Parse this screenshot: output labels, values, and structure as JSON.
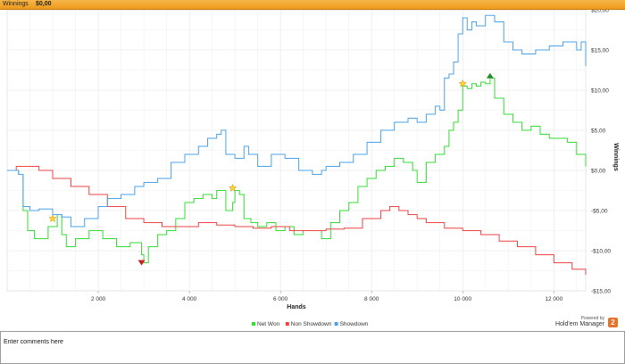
{
  "titlebar": {
    "label": "Winnings",
    "value": "$0,00"
  },
  "chart_data": {
    "type": "line",
    "title": "",
    "xlabel": "Hands",
    "ylabel": "Winnings",
    "xlim": [
      0,
      12700
    ],
    "ylim": [
      -15,
      20
    ],
    "grid": true,
    "legend_placement": "bottom-center",
    "x_ticks": [
      2000,
      4000,
      6000,
      8000,
      10000,
      12000
    ],
    "x_tick_labels": [
      "2 000",
      "4 000",
      "6 000",
      "8 000",
      "10 000",
      "12 000"
    ],
    "y_ticks": [
      -15,
      -10,
      -5,
      0,
      5,
      10,
      15,
      20
    ],
    "y_tick_labels": [
      "-$15,00",
      "-$10,00",
      "-$5,00",
      "$0,00",
      "$5,00",
      "$10,00",
      "$15,00",
      "$20,00"
    ],
    "series": [
      {
        "name": "Net Won",
        "color": "#33dd33",
        "x": [
          0,
          250,
          350,
          450,
          600,
          900,
          1100,
          1200,
          1300,
          1500,
          1800,
          2100,
          2400,
          2700,
          2950,
          3000,
          3100,
          3300,
          3500,
          3700,
          3900,
          4100,
          4300,
          4500,
          4600,
          4800,
          4950,
          5000,
          5100,
          5200,
          5350,
          5500,
          5700,
          5900,
          6100,
          6300,
          6500,
          6700,
          6900,
          7100,
          7300,
          7500,
          7700,
          7900,
          8100,
          8300,
          8500,
          8700,
          8900,
          9000,
          9200,
          9400,
          9600,
          9700,
          9800,
          9900,
          10000,
          10100,
          10200,
          10300,
          10400,
          10500,
          10600,
          10700,
          10900,
          11100,
          11300,
          11500,
          11700,
          11900,
          12100,
          12300,
          12500,
          12700
        ],
        "y": [
          0,
          -0.5,
          -5,
          -7.5,
          -8.5,
          -7,
          -5.5,
          -8,
          -9.5,
          -8.5,
          -7.5,
          -8.5,
          -9.5,
          -9,
          -10.5,
          -11.5,
          -9.5,
          -8,
          -7.5,
          -6,
          -4,
          -3.5,
          -3,
          -3.5,
          -2.5,
          -5,
          -4,
          -2.5,
          -3,
          -6,
          -6.5,
          -7,
          -6.5,
          -7.5,
          -7,
          -8,
          -7.5,
          -7.5,
          -8.5,
          -6.5,
          -5,
          -4,
          -2,
          -1,
          0,
          0.5,
          1.5,
          1,
          0,
          -1.5,
          1,
          2,
          3,
          5,
          6,
          7.5,
          10.5,
          10.2,
          10.8,
          10.5,
          11,
          10.8,
          11.5,
          9,
          7,
          6,
          5,
          5.5,
          4.5,
          4,
          4,
          3.5,
          2,
          0.5
        ]
      },
      {
        "name": "Non Showdown",
        "color": "#ee4444",
        "x": [
          0,
          200,
          400,
          700,
          1000,
          1400,
          1800,
          2200,
          2600,
          3000,
          3400,
          3800,
          4200,
          4600,
          5000,
          5400,
          5800,
          6200,
          6600,
          7000,
          7400,
          7800,
          8200,
          8400,
          8600,
          8800,
          9000,
          9200,
          9600,
          10000,
          10400,
          10800,
          11200,
          11600,
          12000,
          12400,
          12700
        ],
        "y": [
          0,
          0.5,
          0.5,
          0,
          -1,
          -2,
          -3,
          -4.5,
          -6,
          -6.5,
          -7,
          -7,
          -6.5,
          -6.8,
          -7,
          -7.2,
          -7,
          -7.5,
          -7.5,
          -7.3,
          -7.2,
          -6,
          -5,
          -4.5,
          -5,
          -5.5,
          -6,
          -6.5,
          -7.2,
          -7.5,
          -8,
          -8.8,
          -9.5,
          -10.5,
          -11.5,
          -12.3,
          -13
        ]
      },
      {
        "name": "Showdown",
        "color": "#4aa3e8",
        "x": [
          0,
          250,
          350,
          500,
          700,
          1000,
          1200,
          1400,
          1700,
          2000,
          2200,
          2500,
          2800,
          3000,
          3300,
          3600,
          3900,
          4200,
          4400,
          4600,
          4700,
          4800,
          5000,
          5200,
          5300,
          5500,
          5800,
          6100,
          6400,
          6700,
          6900,
          7000,
          7300,
          7600,
          7900,
          8200,
          8500,
          8800,
          9000,
          9200,
          9400,
          9500,
          9600,
          9700,
          9800,
          9900,
          10000,
          10100,
          10200,
          10300,
          10500,
          10700,
          10900,
          11100,
          11300,
          11600,
          11900,
          12200,
          12500,
          12600,
          12700
        ],
        "y": [
          0,
          -0.5,
          -4.5,
          -5,
          -4.8,
          -5.5,
          -5.8,
          -7,
          -6,
          -4.5,
          -3.5,
          -3,
          -2,
          -1.5,
          -1,
          1,
          2,
          3,
          4,
          4.5,
          5,
          2,
          1.5,
          3,
          2,
          0.5,
          2,
          1.5,
          0,
          -0.5,
          0,
          0.5,
          1,
          2,
          3.5,
          5,
          6,
          6.5,
          6,
          7,
          8,
          7.5,
          11.5,
          12,
          13.5,
          17,
          19,
          17.5,
          18.5,
          18,
          19.3,
          18.5,
          16,
          15,
          14.5,
          15,
          15.5,
          16,
          15,
          16,
          13
        ]
      }
    ],
    "annotations": [
      {
        "type": "star",
        "x": 1000,
        "y": -6
      },
      {
        "type": "star",
        "x": 4950,
        "y": -2.2
      },
      {
        "type": "star",
        "x": 10000,
        "y": 10.8
      },
      {
        "type": "triangle-down",
        "x": 2950,
        "y": -11.5
      },
      {
        "type": "triangle-up",
        "x": 10600,
        "y": 11.8
      }
    ]
  },
  "branding": {
    "powered_by": "Powered by",
    "name": "Hold'em Manager",
    "icon_glyph": "2"
  },
  "comments": {
    "placeholder": "Enter comments here"
  }
}
